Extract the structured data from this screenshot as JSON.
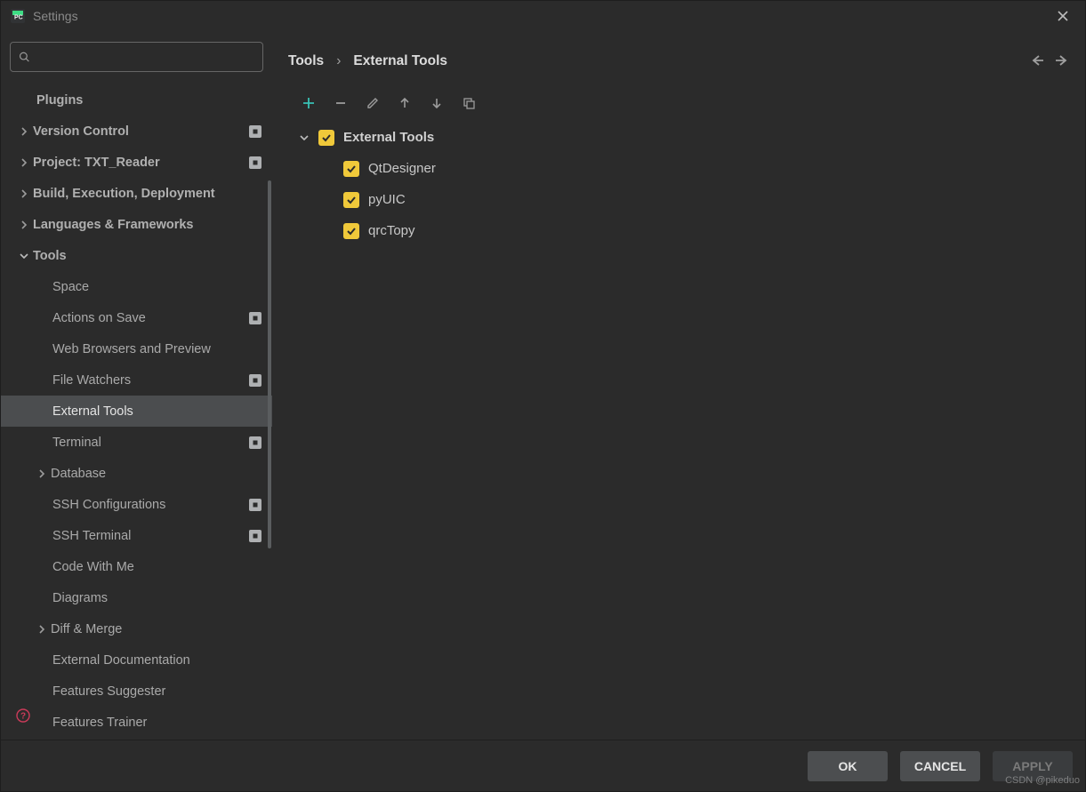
{
  "window": {
    "title": "Settings"
  },
  "search": {
    "placeholder": ""
  },
  "sidebar": {
    "items": [
      {
        "label": "Plugins",
        "depth": 1,
        "chevron": "",
        "badge": false
      },
      {
        "label": "Version Control",
        "depth": 1,
        "chevron": "right",
        "badge": true
      },
      {
        "label": "Project: TXT_Reader",
        "depth": 1,
        "chevron": "right",
        "badge": true
      },
      {
        "label": "Build, Execution, Deployment",
        "depth": 1,
        "chevron": "right",
        "badge": false
      },
      {
        "label": "Languages & Frameworks",
        "depth": 1,
        "chevron": "right",
        "badge": false
      },
      {
        "label": "Tools",
        "depth": 1,
        "chevron": "down",
        "badge": false
      },
      {
        "label": "Space",
        "depth": 2,
        "chevron": "",
        "badge": false
      },
      {
        "label": "Actions on Save",
        "depth": 2,
        "chevron": "",
        "badge": true
      },
      {
        "label": "Web Browsers and Preview",
        "depth": 2,
        "chevron": "",
        "badge": false
      },
      {
        "label": "File Watchers",
        "depth": 2,
        "chevron": "",
        "badge": true
      },
      {
        "label": "External Tools",
        "depth": 2,
        "chevron": "",
        "badge": false,
        "selected": true
      },
      {
        "label": "Terminal",
        "depth": 2,
        "chevron": "",
        "badge": true
      },
      {
        "label": "Database",
        "depth": 2,
        "chevron": "right",
        "badge": false
      },
      {
        "label": "SSH Configurations",
        "depth": 2,
        "chevron": "",
        "badge": true
      },
      {
        "label": "SSH Terminal",
        "depth": 2,
        "chevron": "",
        "badge": true
      },
      {
        "label": "Code With Me",
        "depth": 2,
        "chevron": "",
        "badge": false
      },
      {
        "label": "Diagrams",
        "depth": 2,
        "chevron": "",
        "badge": false
      },
      {
        "label": "Diff & Merge",
        "depth": 2,
        "chevron": "right",
        "badge": false
      },
      {
        "label": "External Documentation",
        "depth": 2,
        "chevron": "",
        "badge": false
      },
      {
        "label": "Features Suggester",
        "depth": 2,
        "chevron": "",
        "badge": false
      },
      {
        "label": "Features Trainer",
        "depth": 2,
        "chevron": "",
        "badge": false
      }
    ]
  },
  "breadcrumb": {
    "root": "Tools",
    "leaf": "External Tools"
  },
  "toolbar": {
    "icons": [
      "add",
      "remove",
      "edit",
      "up",
      "down",
      "copy"
    ]
  },
  "tools_tree": {
    "group": {
      "label": "External Tools",
      "checked": true
    },
    "children": [
      {
        "label": "QtDesigner",
        "checked": true
      },
      {
        "label": "pyUIC",
        "checked": true
      },
      {
        "label": "qrcTopy",
        "checked": true
      }
    ]
  },
  "buttons": {
    "ok": "OK",
    "cancel": "CANCEL",
    "apply": "APPLY"
  },
  "watermark": "CSDN @pikeduo"
}
